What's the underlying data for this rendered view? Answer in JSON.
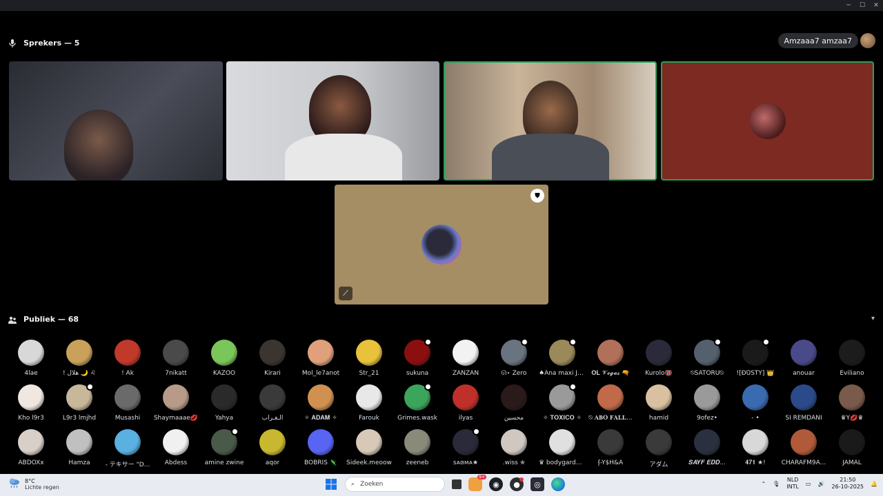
{
  "window": {
    "minimize": "─",
    "maximize": "☐",
    "close": "✕"
  },
  "speakers": {
    "header": "Sprekers — 5",
    "self_name": "Amzaaa7 amzaa7"
  },
  "audience": {
    "header": "Publiek — 68",
    "rows": [
      [
        {
          "name": "4lae",
          "color": "#d8d8d8",
          "badge": false
        },
        {
          "name": "! هلال 🌙 ♌︎",
          "color": "#c9a15a",
          "badge": false
        },
        {
          "name": "! Ak",
          "color": "#c0392b",
          "badge": false
        },
        {
          "name": "7nikatt",
          "color": "#4a4a4a",
          "badge": false
        },
        {
          "name": "KAZOO",
          "color": "#7bc65a",
          "badge": false
        },
        {
          "name": "Kirari",
          "color": "#3a3530",
          "badge": false
        },
        {
          "name": "Mol_le7anot",
          "color": "#e0a07a",
          "badge": false
        },
        {
          "name": "Str_21",
          "color": "#e8c23a",
          "badge": false
        },
        {
          "name": "sukuna",
          "color": "#8b0f0f",
          "badge": true
        },
        {
          "name": "ZANZAN",
          "color": "#f2f2f2",
          "badge": false
        },
        {
          "name": "ᘏ⋆ Zero",
          "color": "#6a7380",
          "badge": true
        },
        {
          "name": "♠Ana maxi Je...",
          "color": "#9a8a5a",
          "badge": true
        },
        {
          "name": "𝐎𝐋 𝓥𝓮𝓰𝓪𝓼 🔫",
          "color": "#b0705a",
          "badge": false
        },
        {
          "name": "Kurolo🔞",
          "color": "#2a2a3a",
          "badge": false
        },
        {
          "name": "⍉SATORU⍉",
          "color": "#55606e",
          "badge": true
        },
        {
          "name": "![ĐŮŠŤŸ] 👑",
          "color": "#1a1a1a",
          "badge": true
        },
        {
          "name": "anouar",
          "color": "#4a4a8a",
          "badge": false
        },
        {
          "name": "Eviliano",
          "color": "#1c1c1c",
          "badge": false
        }
      ],
      [
        {
          "name": "Kho l9r3",
          "color": "#f0e8e0",
          "badge": false
        },
        {
          "name": "L9r3 lmjhd",
          "color": "#c8b89a",
          "badge": true
        },
        {
          "name": "Musashi",
          "color": "#6a6a6a",
          "badge": false
        },
        {
          "name": "Shaymaaae💋",
          "color": "#b89a88",
          "badge": false
        },
        {
          "name": "Yahya",
          "color": "#2a2a2a",
          "badge": false
        },
        {
          "name": "الـغـراب",
          "color": "#3a3a3a",
          "badge": false
        },
        {
          "name": "✧ 𝐀𝐃𝐀𝐌 ✧",
          "color": "#d09050",
          "badge": false
        },
        {
          "name": "Farouk",
          "color": "#e8e8e8",
          "badge": false
        },
        {
          "name": "Grimes.wask",
          "color": "#3ba55c",
          "badge": true
        },
        {
          "name": "ilyas",
          "color": "#c0302a",
          "badge": false
        },
        {
          "name": "محسين",
          "color": "#2a1a1a",
          "badge": false
        },
        {
          "name": "✧ 𝐓𝐎𝐗𝐈𝐂𝐎 ✧",
          "color": "#9a9a9a",
          "badge": true
        },
        {
          "name": "⍉ 𝐀𝐁𝐎 𝐅𝐀𝐋𝐋...",
          "color": "#c06a4a",
          "badge": false
        },
        {
          "name": "hamid",
          "color": "#d8c0a0",
          "badge": false
        },
        {
          "name": "9ofez•",
          "color": "#9a9a9a",
          "badge": false
        },
        {
          "name": "- •",
          "color": "#3a6ab0",
          "badge": false
        },
        {
          "name": "SI REMDANI",
          "color": "#2a4a8a",
          "badge": false
        },
        {
          "name": "♛Y💋♛",
          "color": "#7a5a4a",
          "badge": false
        }
      ],
      [
        {
          "name": "ABDOXx",
          "color": "#d8d0c8",
          "badge": false
        },
        {
          "name": "Hamza",
          "color": "#c0c0c0",
          "badge": false
        },
        {
          "name": "- テキサー \"D...",
          "color": "#5ab0e0",
          "badge": false
        },
        {
          "name": "Abdess",
          "color": "#f0f0f0",
          "badge": false
        },
        {
          "name": "amine zwine",
          "color": "#4a5a4a",
          "badge": true
        },
        {
          "name": "aqor",
          "color": "#c8b830",
          "badge": false
        },
        {
          "name": "BOBRIS 🦎",
          "color": "#5865f2",
          "badge": false
        },
        {
          "name": "Sideek.meoow",
          "color": "#d8c8b8",
          "badge": false
        },
        {
          "name": "zeeneb",
          "color": "#8a8a7a",
          "badge": false
        },
        {
          "name": "ꜱᴀɞᴍᴀ★",
          "color": "#2a2a3a",
          "badge": true
        },
        {
          "name": ".wiss ✯",
          "color": "#d0c8c0",
          "badge": false
        },
        {
          "name": "♛ bodygarde ...",
          "color": "#e0e0e0",
          "badge": false
        },
        {
          "name": "ʄ-Y$H&A",
          "color": "#3a3a3a",
          "badge": false
        },
        {
          "name": "アダム",
          "color": "#3a3a3a",
          "badge": false
        },
        {
          "name": "𝑺𝑨𝒀𝑭 𝑬𝑫𝑫...",
          "color": "#2a3040",
          "badge": false
        },
        {
          "name": "𝟒𝟕𝟏 ★!",
          "color": "#d8d8d8",
          "badge": false
        },
        {
          "name": "CHARAFM9A...",
          "color": "#b05a3a",
          "badge": false
        },
        {
          "name": "JAMAL",
          "color": "#1a1a1a",
          "badge": false
        }
      ]
    ]
  },
  "taskbar": {
    "temperature": "8°C",
    "weather": "Lichte regen",
    "search_placeholder": "Zoeken",
    "notif_count": "9+",
    "lang_top": "NLD",
    "lang_bottom": "INTL",
    "time": "21:50",
    "date": "26-10-2025"
  }
}
